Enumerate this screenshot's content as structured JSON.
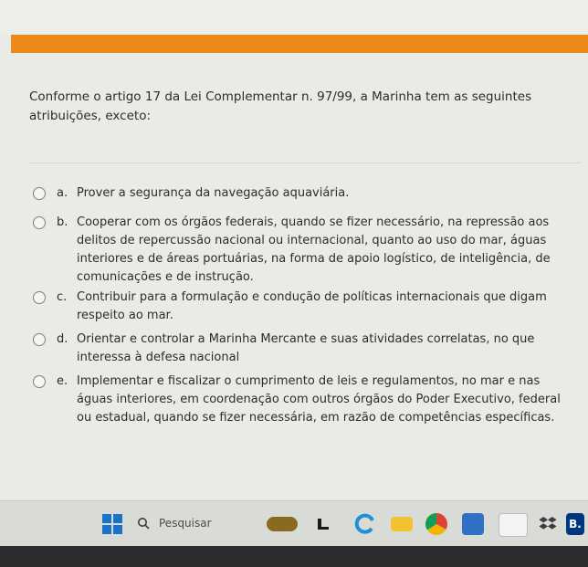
{
  "question": {
    "text": "Conforme o artigo 17 da Lei Complementar n. 97/99, a Marinha tem as seguintes atribuições, exceto:"
  },
  "options": [
    {
      "letter": "a.",
      "text": "Prover a segurança da navegação aquaviária."
    },
    {
      "letter": "b.",
      "text": "Cooperar com os órgãos federais, quando se fizer necessário, na repressão aos delitos de repercussão nacional ou internacional, quanto ao uso do mar, águas interiores e de áreas portuárias, na forma de apoio logístico, de inteligência, de comunicações e de instrução."
    },
    {
      "letter": "c.",
      "text": "Contribuir para a formulação e condução de políticas internacionais que digam respeito ao mar."
    },
    {
      "letter": "d.",
      "text": "Orientar e controlar a Marinha Mercante e suas atividades correlatas, no que interessa à defesa nacional"
    },
    {
      "letter": "e.",
      "text": "Implementar e fiscalizar o cumprimento de leis e regulamentos, no mar e nas águas interiores, em coordenação com outros órgãos do Poder Executivo, federal ou estadual, quando se fizer necessária, em razão de competências específicas."
    }
  ],
  "taskbar": {
    "search_label": "Pesquisar",
    "apps": [
      {
        "name": "start-icon"
      },
      {
        "name": "search-icon"
      },
      {
        "name": "widget-icon",
        "color": "#d9a020"
      },
      {
        "name": "file-explorer-icon",
        "color": "#f0c430"
      },
      {
        "name": "edge-icon",
        "color": "#1f8fd6"
      },
      {
        "name": "chrome-icon",
        "color": "#3aa757"
      },
      {
        "name": "store-icon",
        "color": "#2f6fc4"
      },
      {
        "name": "amazon-icon",
        "color": "#ff9900"
      },
      {
        "name": "dropbox-icon",
        "color": "#0061fe"
      },
      {
        "name": "booking-icon",
        "color": "#003580"
      }
    ],
    "booking_letter": "B."
  },
  "colors": {
    "accent": "#e98a1b",
    "background": "#e9ebe6",
    "taskbar": "#d9dbd7"
  }
}
